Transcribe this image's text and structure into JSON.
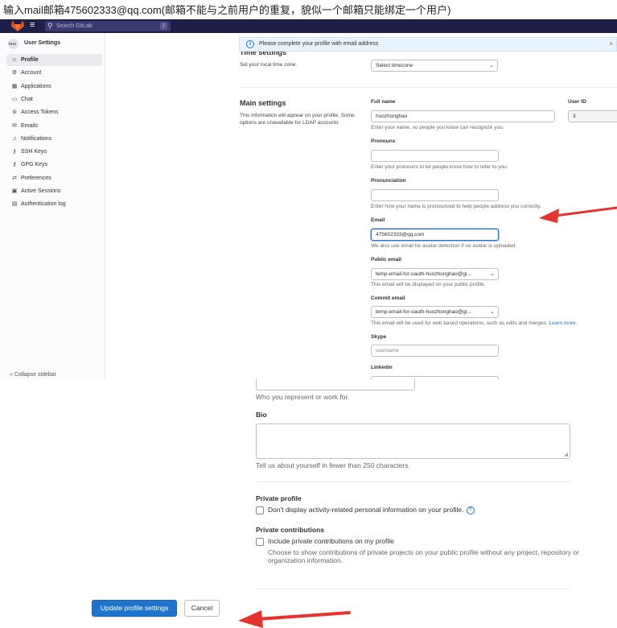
{
  "caption": "输入mail邮箱475602333@qq.com(邮箱不能与之前用户的重复，貌似一个邮箱只能绑定一个用户)",
  "navbar": {
    "search_placeholder": "Search GitLab",
    "search_shortcut": "/"
  },
  "sidebar": {
    "avatar_text": "huo",
    "title": "User Settings",
    "items": [
      {
        "label": "Profile",
        "icon": "user-circle-icon",
        "glyph": "☺",
        "active": true
      },
      {
        "label": "Account",
        "icon": "account-icon",
        "glyph": "⚙"
      },
      {
        "label": "Applications",
        "icon": "applications-icon",
        "glyph": "▦"
      },
      {
        "label": "Chat",
        "icon": "chat-icon",
        "glyph": "▭"
      },
      {
        "label": "Access Tokens",
        "icon": "token-icon",
        "glyph": "⊜"
      },
      {
        "label": "Emails",
        "icon": "mail-icon",
        "glyph": "✉"
      },
      {
        "label": "Notifications",
        "icon": "bell-icon",
        "glyph": "♫"
      },
      {
        "label": "SSH Keys",
        "icon": "key-icon",
        "glyph": "⚷"
      },
      {
        "label": "GPG Keys",
        "icon": "key-icon",
        "glyph": "⚷"
      },
      {
        "label": "Preferences",
        "icon": "preferences-icon",
        "glyph": "⇄"
      },
      {
        "label": "Active Sessions",
        "icon": "monitor-icon",
        "glyph": "▣"
      },
      {
        "label": "Authentication log",
        "icon": "log-icon",
        "glyph": "▤"
      }
    ],
    "collapse_label": "« Collapse sidebar"
  },
  "alert": {
    "text": "Please complete your profile with email address",
    "close": "×"
  },
  "time_settings": {
    "heading_partial": "Time settings",
    "description": "Set your local time zone.",
    "select_value": "Select timezone"
  },
  "main_settings": {
    "title": "Main settings",
    "description": "This information will appear on your profile. Some options are unavailable for LDAP accounts",
    "full_name": {
      "label": "Full name",
      "value": "huozhonghao",
      "help": "Enter your name, so people you know can recognize you."
    },
    "user_id": {
      "label": "User ID",
      "value": "3"
    },
    "pronouns": {
      "label": "Pronouns",
      "value": "",
      "help": "Enter your pronouns to let people know how to refer to you."
    },
    "pronunciation": {
      "label": "Pronunciation",
      "value": "",
      "help": "Enter how your name is pronounced to help people address you correctly."
    },
    "email": {
      "label": "Email",
      "value": "475602333@qq.com",
      "help": "We also use email for avatar detection if no avatar is uploaded."
    },
    "public_email": {
      "label": "Public email",
      "value": "temp-email-for-oauth-huozhonghao@gi...",
      "help": "This email will be displayed on your public profile."
    },
    "commit_email": {
      "label": "Commit email",
      "value": "temp-email-for-oauth-huozhonghao@gi...",
      "help": "This email will be used for web based operations, such as edits and merges.",
      "help_link": "Learn more."
    },
    "skype": {
      "label": "Skype",
      "placeholder": "username"
    },
    "linkedin": {
      "label": "Linkedin"
    }
  },
  "lower": {
    "org_help": "Who you represent or work for.",
    "bio_label": "Bio",
    "bio_help": "Tell us about yourself in fewer than 250 characters.",
    "private_profile_title": "Private profile",
    "private_profile_checkbox": "Don't display activity-related personal information on your profile.",
    "private_contrib_title": "Private contributions",
    "private_contrib_checkbox": "Include private contributions on my profile",
    "private_contrib_help": "Choose to show contributions of private projects on your public profile without any project, repository or organization information.",
    "update_button": "Update profile settings",
    "cancel_button": "Cancel"
  },
  "colors": {
    "navbar": "#1f1e47",
    "primary": "#1f75cb",
    "annotation_arrow": "#e8322d"
  }
}
